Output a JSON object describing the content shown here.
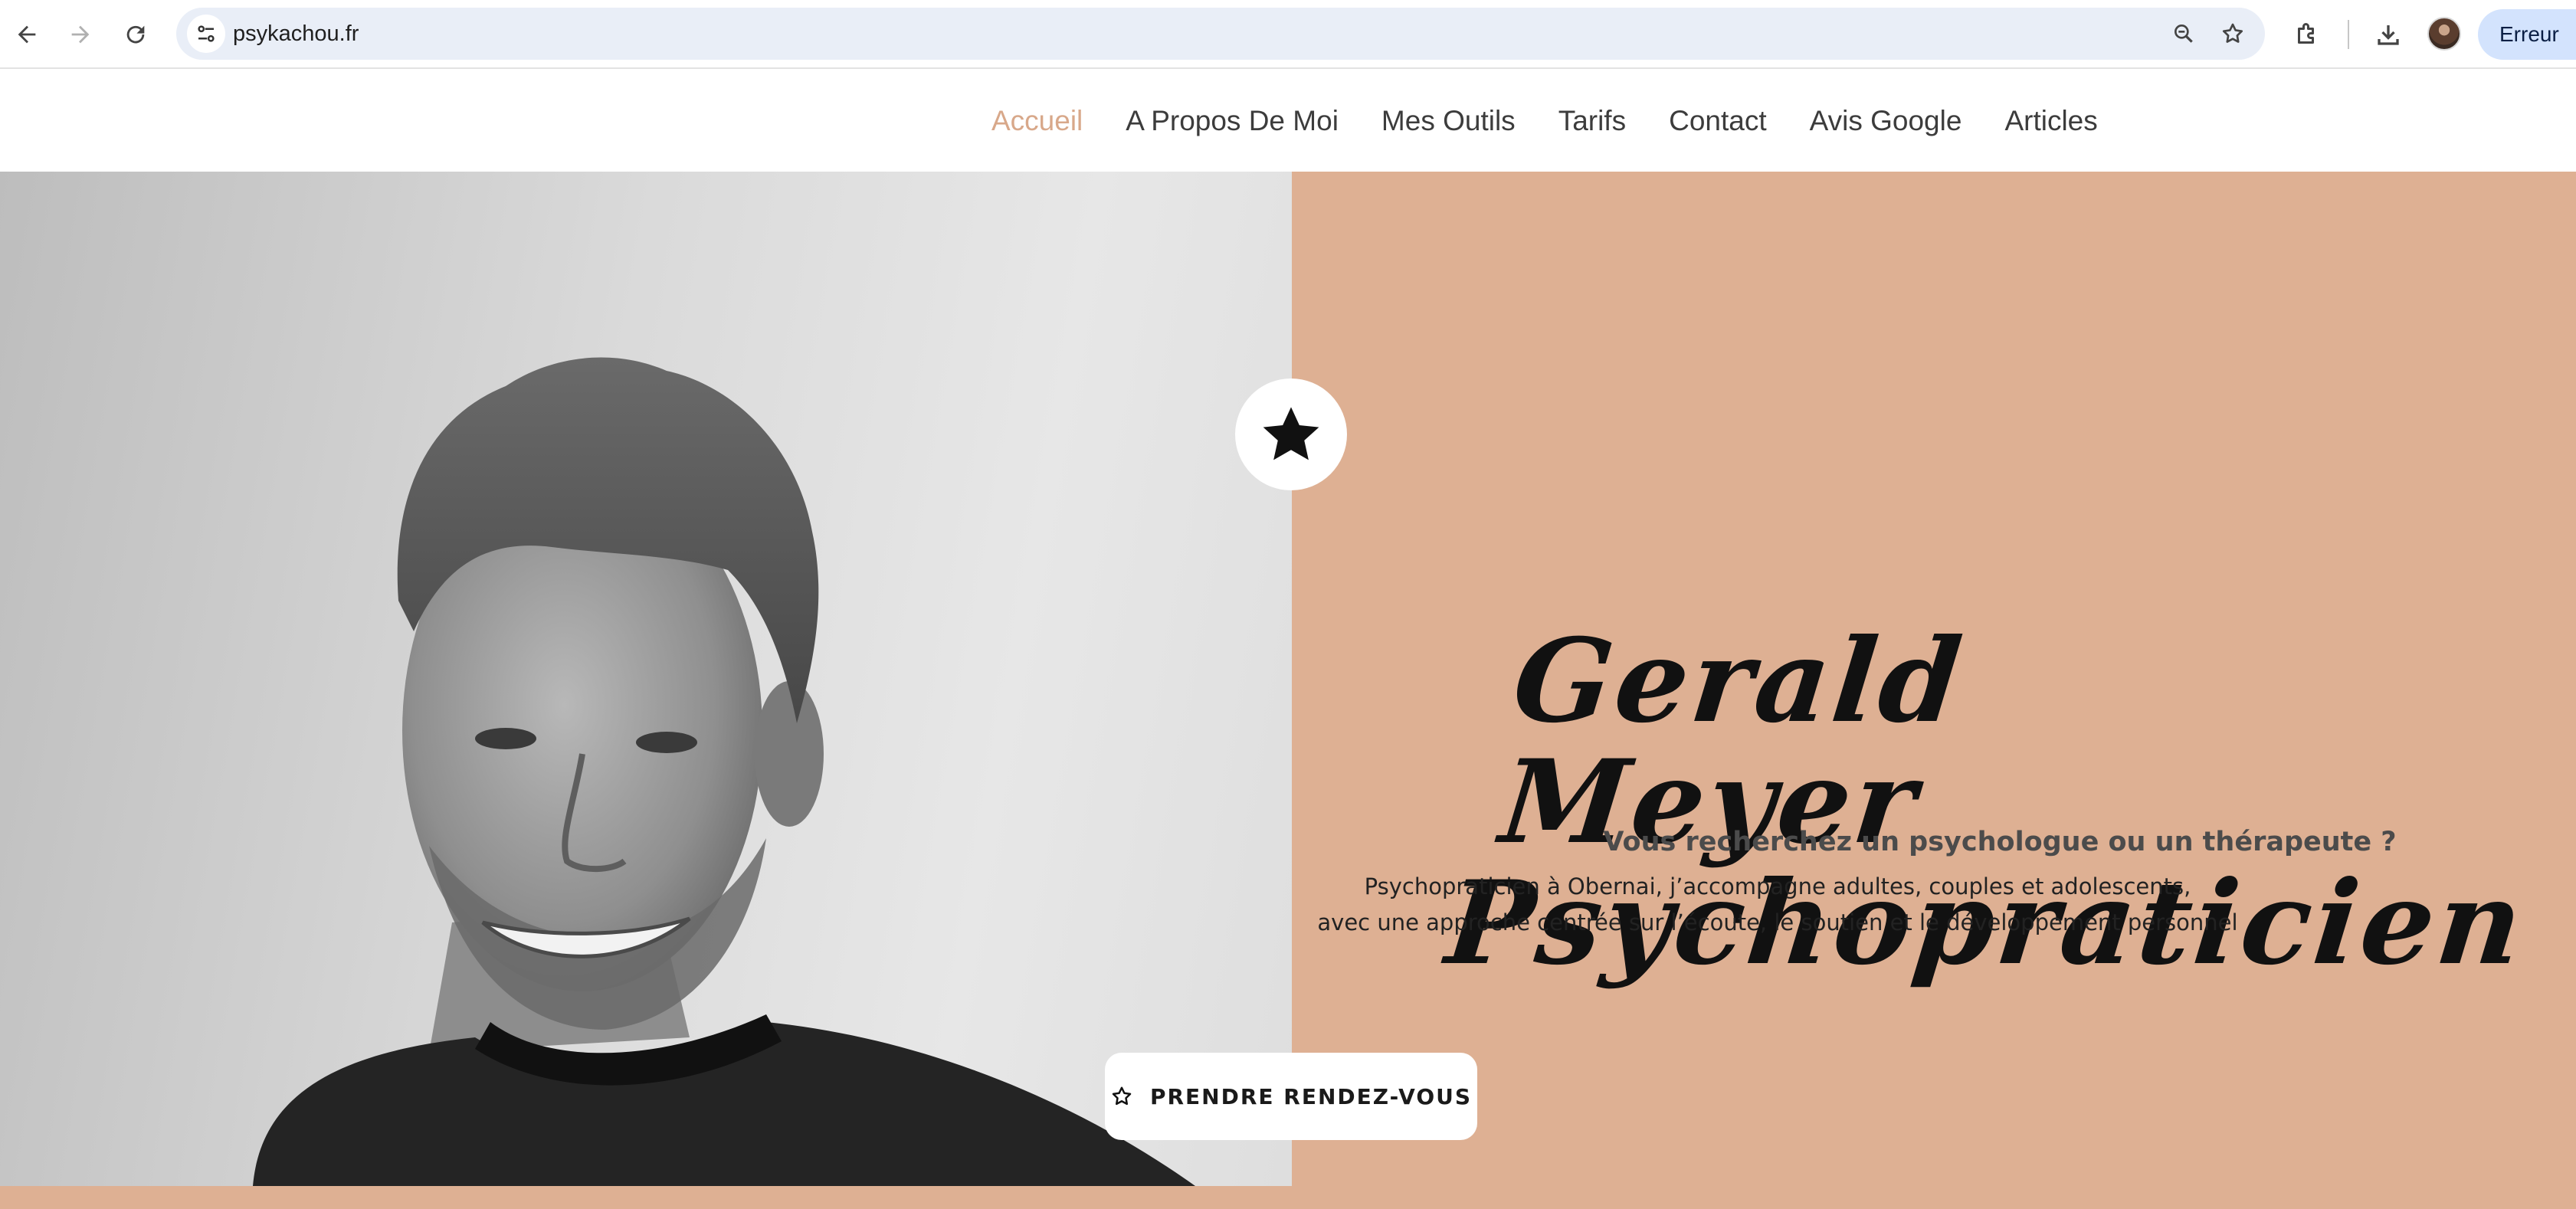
{
  "browser": {
    "url": "psykachou.fr",
    "profile_chip": "Erreur"
  },
  "icons": {
    "back": "arrow-left-icon",
    "forward": "arrow-right-icon",
    "reload": "reload-icon",
    "site_info": "tune-icon",
    "zoom": "zoom-icon",
    "bookmark": "star-outline-icon",
    "extensions": "puzzle-icon",
    "downloads": "download-icon",
    "badge": "star-filled-icon",
    "cta": "star-outline-icon"
  },
  "nav": {
    "items": [
      {
        "label": "Accueil",
        "active": true
      },
      {
        "label": "A Propos De Moi"
      },
      {
        "label": "Mes Outils"
      },
      {
        "label": "Tarifs"
      },
      {
        "label": "Contact"
      },
      {
        "label": "Avis Google"
      },
      {
        "label": "Articles"
      }
    ]
  },
  "hero": {
    "title_line1": "Gerald Meyer",
    "title_line2": "Psychopraticien",
    "subtitle": "Vous recherchez un psychologue ou un thérapeute ?",
    "intro_line1": "Psychopraticien à Obernai, j’accompagne adultes, couples et adolescents,",
    "intro_line2": "avec une approche centrée sur l’écoute, le soutien et le développement personnel",
    "cta_label": "PRENDRE RENDEZ-VOUS"
  },
  "colors": {
    "accent": "#deb093",
    "active_nav": "#d8a88a",
    "text_dark": "#111111"
  }
}
